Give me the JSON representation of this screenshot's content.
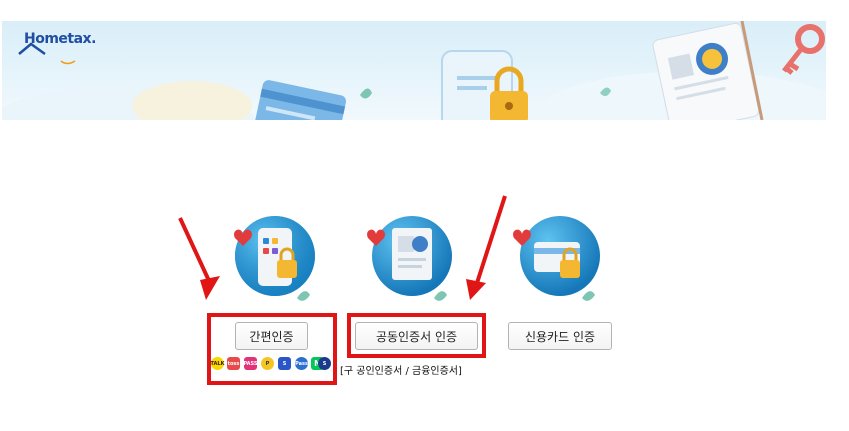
{
  "header": {
    "logo_text": "Hometax."
  },
  "auth": {
    "easy_label": "간편인증",
    "cert_label": "공동인증서 인증",
    "cert_note": "[구 공인인증서 / 금융인증서]",
    "card_label": "신용카드 인증",
    "easy_providers": [
      "kakao-icon",
      "toss-icon",
      "pass-icon",
      "payco-icon",
      "samsung-pass-icon",
      "kb-icon",
      "naver-icon",
      "shinhan-icon"
    ]
  },
  "colors": {
    "highlight": "#e01616",
    "arrow": "#e01616",
    "logo": "#1f4ea3",
    "circle": "#1f8fd0"
  }
}
